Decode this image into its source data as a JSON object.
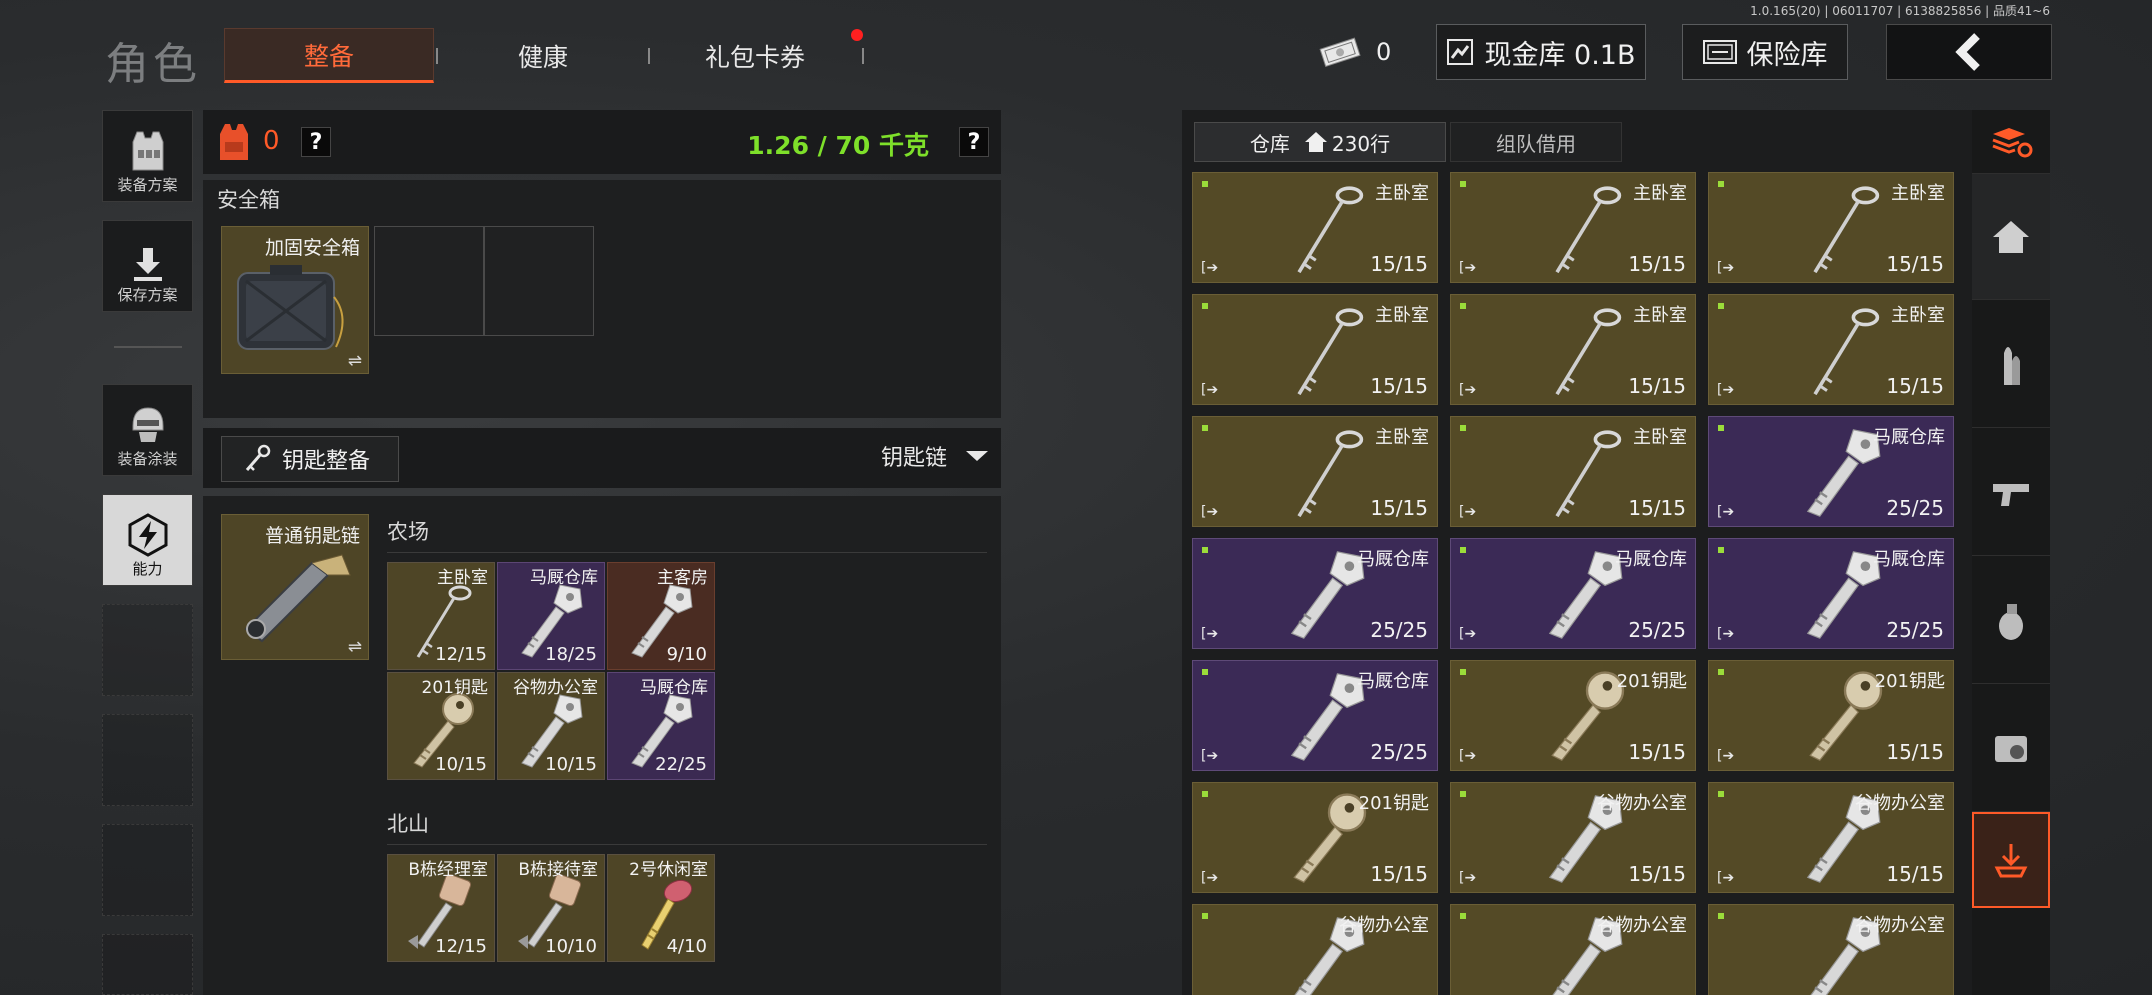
{
  "version": "1.0.165(20) | 06011707 | 6138825856 | 品质41~6",
  "header": {
    "title": "角色",
    "tabs": [
      {
        "label": "整备",
        "active": true
      },
      {
        "label": "健康",
        "active": false
      },
      {
        "label": "礼包卡券",
        "active": false,
        "notify": true
      }
    ],
    "cash_count": "0",
    "cash_label": "现金库 0.1B",
    "safe_label": "保险库"
  },
  "left_nav": [
    {
      "label": "装备方案",
      "icon": "vest-icon"
    },
    {
      "label": "保存方案",
      "icon": "download-icon"
    },
    {
      "label": "装备涂装",
      "icon": "helmet-icon"
    },
    {
      "label": "能力",
      "icon": "ability-icon",
      "active": true
    }
  ],
  "loadout": {
    "armor_count": "0",
    "help": "?",
    "weight": "1.26 / 70 千克",
    "safebox_title": "安全箱",
    "safebox_item": "加固安全箱",
    "swap_symbol": "⇌",
    "key_section_label": "钥匙整备",
    "keychain_dropdown": "钥匙链",
    "keychain_item": "普通钥匙链",
    "groups": [
      {
        "name": "农场",
        "keys": [
          {
            "name": "主卧室",
            "count": "12/15",
            "color": "gold",
            "type": "thin"
          },
          {
            "name": "马厩仓库",
            "count": "18/25",
            "color": "purple",
            "type": "flat"
          },
          {
            "name": "主客房",
            "count": "9/10",
            "color": "brown",
            "type": "flat"
          },
          {
            "name": "201钥匙",
            "count": "10/15",
            "color": "gold",
            "type": "round"
          },
          {
            "name": "谷物办公室",
            "count": "10/15",
            "color": "gold",
            "type": "flat"
          },
          {
            "name": "马厩仓库",
            "count": "22/25",
            "color": "purple",
            "type": "flat"
          }
        ]
      },
      {
        "name": "北山",
        "keys": [
          {
            "name": "B栋经理室",
            "count": "12/15",
            "color": "gold",
            "type": "tag"
          },
          {
            "name": "B栋接待室",
            "count": "10/10",
            "color": "gold",
            "type": "tag"
          },
          {
            "name": "2号休闲室",
            "count": "4/10",
            "color": "gold",
            "type": "brass"
          }
        ]
      }
    ]
  },
  "warehouse": {
    "tab_storage": "仓库",
    "rows_label": "230行",
    "tab_team": "组队借用",
    "move_symbol": "[➔",
    "items": [
      {
        "name": "主卧室",
        "count": "15/15",
        "color": "gold",
        "type": "thin"
      },
      {
        "name": "主卧室",
        "count": "15/15",
        "color": "gold",
        "type": "thin"
      },
      {
        "name": "主卧室",
        "count": "15/15",
        "color": "gold",
        "type": "thin"
      },
      {
        "name": "主卧室",
        "count": "15/15",
        "color": "gold",
        "type": "thin"
      },
      {
        "name": "主卧室",
        "count": "15/15",
        "color": "gold",
        "type": "thin"
      },
      {
        "name": "主卧室",
        "count": "15/15",
        "color": "gold",
        "type": "thin"
      },
      {
        "name": "主卧室",
        "count": "15/15",
        "color": "gold",
        "type": "thin"
      },
      {
        "name": "主卧室",
        "count": "15/15",
        "color": "gold",
        "type": "thin"
      },
      {
        "name": "马厩仓库",
        "count": "25/25",
        "color": "purple",
        "type": "flat"
      },
      {
        "name": "马厩仓库",
        "count": "25/25",
        "color": "purple",
        "type": "flat"
      },
      {
        "name": "马厩仓库",
        "count": "25/25",
        "color": "purple",
        "type": "flat"
      },
      {
        "name": "马厩仓库",
        "count": "25/25",
        "color": "purple",
        "type": "flat"
      },
      {
        "name": "马厩仓库",
        "count": "25/25",
        "color": "purple",
        "type": "flat"
      },
      {
        "name": "201钥匙",
        "count": "15/15",
        "color": "gold",
        "type": "round"
      },
      {
        "name": "201钥匙",
        "count": "15/15",
        "color": "gold",
        "type": "round"
      },
      {
        "name": "201钥匙",
        "count": "15/15",
        "color": "gold",
        "type": "round"
      },
      {
        "name": "谷物办公室",
        "count": "15/15",
        "color": "gold",
        "type": "flat"
      },
      {
        "name": "谷物办公室",
        "count": "15/15",
        "color": "gold",
        "type": "flat"
      },
      {
        "name": "谷物办公室",
        "count": "",
        "color": "gold",
        "type": "flat"
      },
      {
        "name": "谷物办公室",
        "count": "",
        "color": "gold",
        "type": "flat"
      },
      {
        "name": "谷物办公室",
        "count": "",
        "color": "gold",
        "type": "flat"
      }
    ]
  },
  "right_nav": [
    {
      "icon": "stack-refresh-icon"
    },
    {
      "icon": "home-icon"
    },
    {
      "icon": "ammo-icon"
    },
    {
      "icon": "gun-icon"
    },
    {
      "icon": "grenade-icon"
    },
    {
      "icon": "meds-icon"
    },
    {
      "icon": "special-key-icon"
    }
  ],
  "colors": {
    "accent": "#ff5a28",
    "weight": "#7ee02a",
    "gold_tile": "#544a26",
    "purple_tile": "#3b2a56"
  }
}
